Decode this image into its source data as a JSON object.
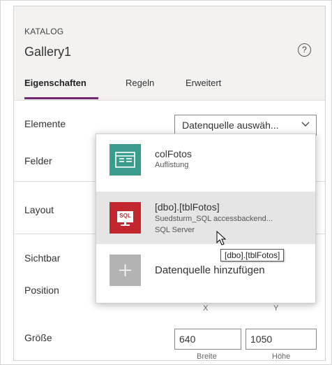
{
  "header": {
    "section_label": "KATALOG",
    "control_name": "Gallery1",
    "help_symbol": "?"
  },
  "tabs": [
    {
      "label": "Eigenschaften",
      "active": true
    },
    {
      "label": "Regeln",
      "active": false
    },
    {
      "label": "Erweitert",
      "active": false
    }
  ],
  "properties": {
    "elemente_label": "Elemente",
    "elemente_value": "Datenquelle auswäh...",
    "felder_label": "Felder",
    "layout_label": "Layout",
    "sichtbar_label": "Sichtbar",
    "position_label": "Position",
    "x_caption": "X",
    "y_caption": "Y",
    "groesse_label": "Größe",
    "width_value": "640",
    "height_value": "1050",
    "width_caption": "Breite",
    "height_caption": "Höhe"
  },
  "dropdown": {
    "items": [
      {
        "title": "colFotos",
        "subtitle": "Auflistung",
        "icon": "collection-icon",
        "color": "#3b9c8e"
      },
      {
        "title": "[dbo].[tblFotos]",
        "subtitle": "Suedsturm_SQL accessbackend...",
        "subtitle2": "SQL Server",
        "icon": "sql-server-icon",
        "icon_text": "SQL",
        "color": "#c4262e"
      },
      {
        "title": "Datenquelle hinzufügen",
        "icon": "plus-icon",
        "color": "#b3b3b3"
      }
    ],
    "tooltip": "[dbo].[tblFotos]"
  },
  "colors": {
    "accent": "#742774",
    "header_bg": "#f3f2f1",
    "hover_bg": "#e5e5e5"
  }
}
